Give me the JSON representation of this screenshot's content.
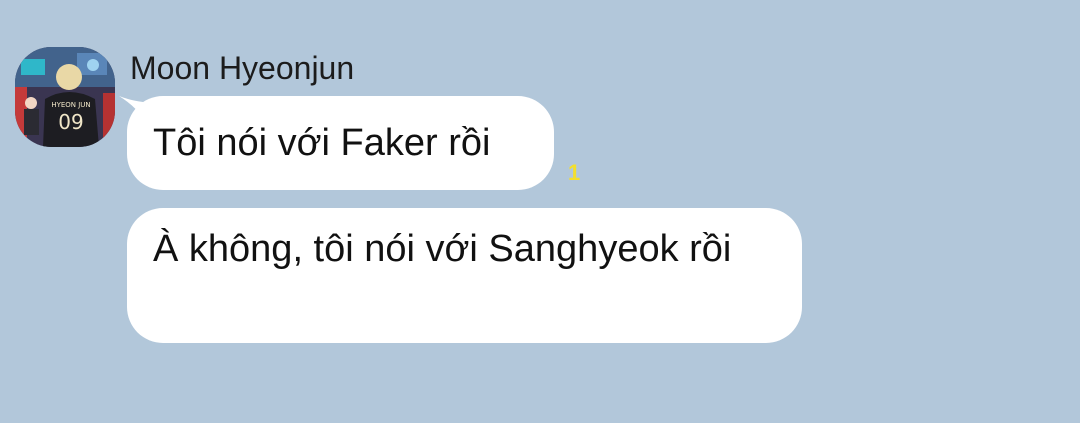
{
  "chat": {
    "sender": {
      "name": "Moon Hyeonjun",
      "avatar_jersey_name": "HYEON JUN",
      "avatar_jersey_number": "09"
    },
    "messages": [
      {
        "text": "Tôi nói với Faker rồi",
        "unread_count": "1"
      },
      {
        "text": "À không, tôi nói với Sanghyeok rồi"
      }
    ]
  },
  "colors": {
    "background": "#b2c7da",
    "bubble": "#ffffff",
    "unread_count": "#f3df2c"
  }
}
